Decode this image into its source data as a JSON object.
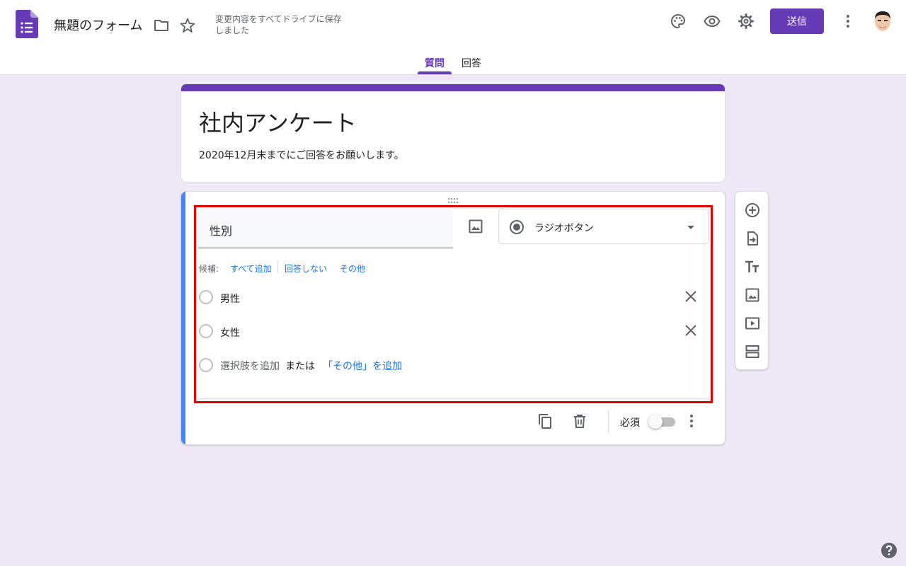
{
  "header": {
    "title": "無題のフォーム",
    "save_status": "変更内容をすべてドライブに保存しました",
    "send_label": "送信",
    "icons": [
      "forms-logo-icon",
      "folder-icon",
      "star-icon",
      "palette-icon",
      "preview-eye-icon",
      "settings-gear-icon",
      "more-vert-icon",
      "avatar"
    ],
    "tabs": [
      {
        "label": "質問",
        "active": true
      },
      {
        "label": "回答",
        "active": false
      }
    ]
  },
  "form": {
    "title": "社内アンケート",
    "description": "2020年12月末までにご回答をお願いします。"
  },
  "question": {
    "text": "性別",
    "type": "ラジオボタン",
    "suggestions_label": "候補:",
    "suggestions": [
      "すべて追加",
      "回答しない",
      "その他"
    ],
    "options": [
      "男性",
      "女性"
    ],
    "add_option": "選択肢を追加",
    "add_or": "または",
    "add_other": "「その他」を追加",
    "required_label": "必須",
    "required": false
  },
  "side_toolbar": {
    "icons": [
      "add-question-icon",
      "import-questions-icon",
      "add-title-icon",
      "add-image-icon",
      "add-video-icon",
      "add-section-icon"
    ]
  },
  "colors": {
    "primary": "#673ab7",
    "background": "#ede7f6",
    "active_accent": "#4285f4",
    "link": "#1a73e8",
    "highlight": "#e00000"
  }
}
